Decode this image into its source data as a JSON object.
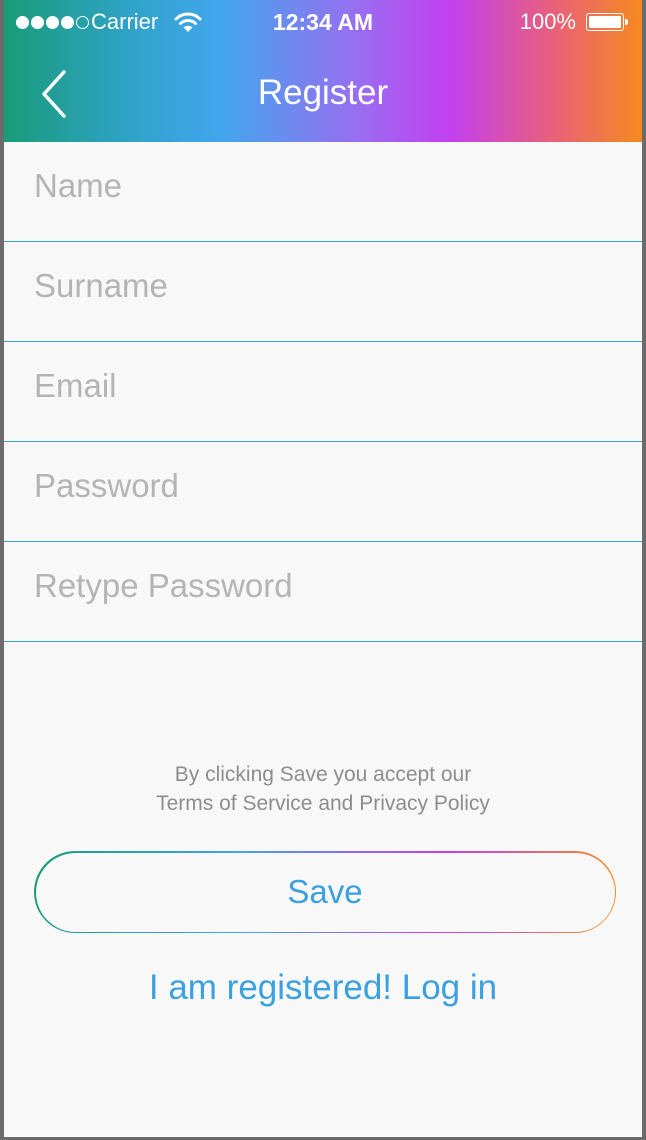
{
  "status_bar": {
    "carrier": "Carrier",
    "time": "12:34 AM",
    "battery": "100%",
    "signal_bars_filled": 4,
    "signal_bars_total": 5
  },
  "nav": {
    "title": "Register",
    "back_icon": "chevron-left-icon"
  },
  "form": {
    "fields": [
      {
        "placeholder": "Name",
        "value": ""
      },
      {
        "placeholder": "Surname",
        "value": ""
      },
      {
        "placeholder": "Email",
        "value": ""
      },
      {
        "placeholder": "Password",
        "value": ""
      },
      {
        "placeholder": "Retype Password",
        "value": ""
      }
    ]
  },
  "terms": {
    "line1": "By clicking Save you accept our",
    "line2": "Terms of Service and Privacy Policy"
  },
  "actions": {
    "save_label": "Save",
    "login_label": "I am registered! Log in"
  },
  "colors": {
    "accent": "#3aa0e0",
    "divider": "#3aa4b8",
    "gradient": [
      "#1a9b78",
      "#42a6ee",
      "#c23ff0",
      "#f58a1e"
    ]
  }
}
